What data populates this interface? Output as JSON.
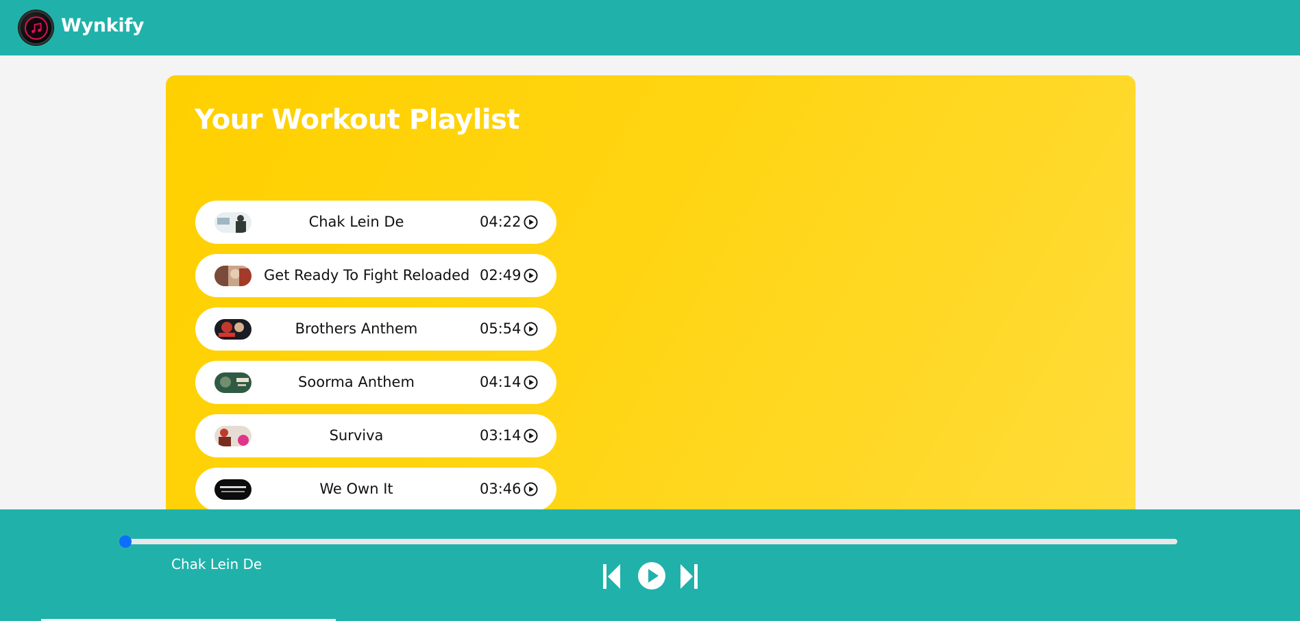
{
  "app": {
    "brand": "Wynkify"
  },
  "playlist": {
    "title": "Your Workout Playlist",
    "songs": [
      {
        "title": "Chak Lein De",
        "duration": "04:22",
        "thumb": "chak-lein-de-thumbnail"
      },
      {
        "title": "Get Ready To Fight Reloaded",
        "duration": "02:49",
        "thumb": "get-ready-to-fight-thumbnail"
      },
      {
        "title": "Brothers Anthem",
        "duration": "05:54",
        "thumb": "brothers-anthem-thumbnail"
      },
      {
        "title": "Soorma Anthem",
        "duration": "04:14",
        "thumb": "soorma-anthem-thumbnail"
      },
      {
        "title": "Surviva",
        "duration": "03:14",
        "thumb": "surviva-thumbnail"
      },
      {
        "title": "We Own It",
        "duration": "03:46",
        "thumb": "we-own-it-thumbnail"
      }
    ]
  },
  "player": {
    "now_playing": "Chak Lein De",
    "progress_fraction": 0.0,
    "controls": [
      "skip-previous-icon",
      "play-icon",
      "skip-next-icon"
    ]
  },
  "colors": {
    "header": "#20b2aa",
    "card": "#ffd200",
    "accent": "#0d6efd"
  }
}
